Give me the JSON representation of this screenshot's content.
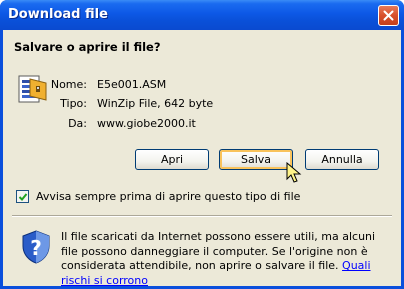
{
  "window": {
    "title": "Download file"
  },
  "dialog": {
    "question": "Salvare o aprire il file?",
    "fields": [
      {
        "label": "Nome:",
        "value": "E5e001.ASM"
      },
      {
        "label": "Tipo:",
        "value": "WinZip File, 642 byte"
      },
      {
        "label": "Da:",
        "value": "www.giobe2000.it"
      }
    ],
    "buttons": {
      "open": "Apri",
      "save": "Salva",
      "cancel": "Annulla"
    },
    "checkbox": {
      "label": "Avvisa sempre prima di aprire questo tipo di file",
      "checked": true
    },
    "info": {
      "text": "Il file scaricati da Internet possono essere utili, ma alcuni file possono danneggiare il computer. Se l'origine non è considerata attendibile, non aprire o salvare il file.",
      "link": "Quali rischi si corrono"
    },
    "icons": {
      "file": "winzip-file-icon",
      "shield": "security-shield-icon",
      "close": "close-icon",
      "cursor": "mouse-pointer-icon"
    }
  }
}
